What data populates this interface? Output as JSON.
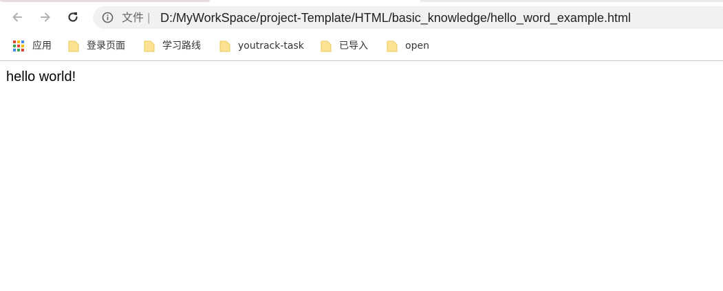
{
  "browser": {
    "address_bar": {
      "scheme_label": "文件",
      "separator": "|",
      "url": "D:/MyWorkSpace/project-Template/HTML/basic_knowledge/hello_word_example.html"
    },
    "nav": {
      "back_icon": "arrow-left-icon",
      "forward_icon": "arrow-right-icon",
      "reload_icon": "reload-icon"
    },
    "bookmarks": [
      {
        "label": "应用",
        "icon": "apps-grid-icon"
      },
      {
        "label": "登录页面",
        "icon": "folder-icon"
      },
      {
        "label": "学习路线",
        "icon": "folder-icon"
      },
      {
        "label": "youtrack-task",
        "icon": "folder-icon"
      },
      {
        "label": "已导入",
        "icon": "folder-icon"
      },
      {
        "label": "open",
        "icon": "folder-icon"
      }
    ]
  },
  "page": {
    "body_text": "hello world!"
  },
  "colors": {
    "omnibox_bg": "#f1f1f1",
    "folder_yellow": "#fde293",
    "text_dark": "#202124"
  }
}
